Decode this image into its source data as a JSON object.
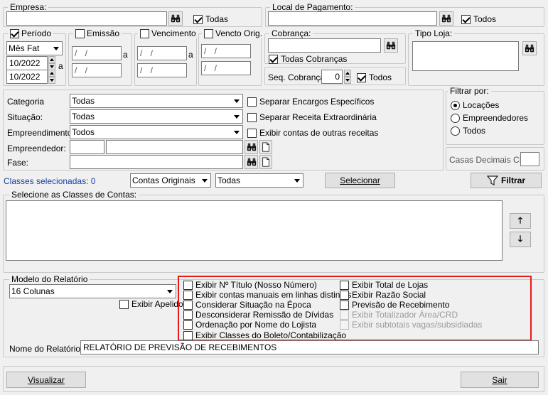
{
  "empresa": {
    "title": "Empresa:",
    "todos_label": "Todas",
    "todos_checked": true
  },
  "local_pagamento": {
    "title": "Local de Pagamento:",
    "todos_label": "Todos",
    "todos_checked": true
  },
  "periodo": {
    "title": "Período",
    "checked": true,
    "mode": "Mês Fat",
    "start": "10/2022",
    "end": "10/2022",
    "sep": "a"
  },
  "emissao": {
    "title": "Emissão",
    "checked": false,
    "start": "/ /",
    "end": "/ /",
    "sep": "a"
  },
  "vencimento": {
    "title": "Vencimento",
    "checked": false,
    "start": "/ /",
    "end": "/ /",
    "sep": "a"
  },
  "vencto_orig": {
    "title": "Vencto Orig.",
    "checked": false,
    "start": "/ /",
    "end": "/ /"
  },
  "cobranca": {
    "title": "Cobrança:",
    "todas_label": "Todas Cobranças",
    "todas_checked": true,
    "seq_label": "Seq. Cobrança:",
    "seq_value": "0",
    "seq_todos_label": "Todos",
    "seq_todos_checked": true
  },
  "tipo_loja": {
    "title": "Tipo Loja:"
  },
  "filters": {
    "categoria_label": "Categoria",
    "categoria_value": "Todas",
    "situacao_label": "Situação:",
    "situacao_value": "Todas",
    "empreendimento_label": "Empreendimento:",
    "empreendimento_value": "Todos",
    "empreendedor_label": "Empreendedor:",
    "fase_label": "Fase:",
    "separar_encargos": "Separar Encargos Específicos",
    "separar_receita": "Separar Receita Extraordinária",
    "exibir_outras": "Exibir contas de outras receitas"
  },
  "filtrar_por": {
    "title": "Filtrar por:",
    "options": [
      "Locações",
      "Empreendedores",
      "Todos"
    ],
    "selected": 0
  },
  "casas_decimais": {
    "label": "Casas Decimais CRD",
    "value": ""
  },
  "classes": {
    "selected_text": "Classes selecionadas: 0",
    "contas_value": "Contas Originais",
    "todas_value": "Todas",
    "selecionar_label": "Selecionar",
    "filtrar_label": "Filtrar",
    "list_title": "Selecione as Classes de Contas:"
  },
  "modelo": {
    "title": "Modelo do Relatório",
    "value": "16 Colunas",
    "exibir_apelido": "Exibir Apelido",
    "nome_label": "Nome do Relatório:",
    "nome_value": "RELATÓRIO DE PREVISÃO DE RECEBIMENTOS"
  },
  "options_left": [
    {
      "label": "Exibir Nº Título (Nosso Número)",
      "enabled": true
    },
    {
      "label": "Exibir contas manuais em linhas distintas",
      "enabled": true
    },
    {
      "label": "Considerar Situação na Época",
      "enabled": true
    },
    {
      "label": "Desconsiderar Remissão de Dívidas",
      "enabled": true
    },
    {
      "label": "Ordenação por Nome do Lojista",
      "enabled": true
    },
    {
      "label": "Exibir Classes do Boleto/Contabilização",
      "enabled": true
    }
  ],
  "options_right": [
    {
      "label": "Exibir Total de Lojas",
      "enabled": true
    },
    {
      "label": "Exibir Razão Social",
      "enabled": true
    },
    {
      "label": "Previsão de Recebimento",
      "enabled": true
    },
    {
      "label": "Exibir Totalizador Área/CRD",
      "enabled": false
    },
    {
      "label": "Exibir subtotais vagas/subsidiadas",
      "enabled": false
    }
  ],
  "footer": {
    "visualizar_label": "Visualizar",
    "sair_label": "Sair"
  },
  "colors": {
    "highlight": "#e31b1b",
    "link_text": "#1a3fa8"
  }
}
